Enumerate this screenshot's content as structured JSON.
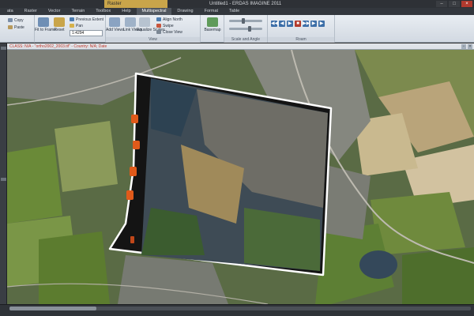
{
  "window": {
    "title": "Untitled1 - ERDAS IMAGINE 2011",
    "contextual_tab": "Raster",
    "controls": [
      "–",
      "□",
      "×"
    ]
  },
  "menu": {
    "tabs": [
      "ata",
      "Raster",
      "Vector",
      "Terrain",
      "Toolbox",
      "Help",
      "Multispectral",
      "Drawing",
      "Format",
      "Table"
    ]
  },
  "ribbon": {
    "edit": {
      "copy": "Copy",
      "paste": "Paste"
    },
    "extent": {
      "fit_to_frame": "Fit to Frame",
      "reset": "Reset",
      "previous_extent": "Previous Extent",
      "pan": "Pan",
      "scale_value": "1:4294"
    },
    "view": {
      "add_views": "Add Views",
      "link_views": "Link Views",
      "equalize_scales": "Equalize Scales",
      "align_north": "Align North",
      "swipe": "Swipe",
      "close_view": "Close View",
      "basemap": "Basemap",
      "label": "View"
    },
    "scale_labels": {
      "label": "Scale and Angle"
    },
    "roam": {
      "label": "Roam"
    },
    "nav_buttons": [
      "◀◀",
      "◀",
      "▶",
      "■",
      "▶▶",
      "▶",
      "▶"
    ]
  },
  "viewer": {
    "title": "CLASS: N/A - \"ortho2002_2003.tif\" - Country: N/A; Date"
  },
  "status": {
    "text": ""
  },
  "colors": {
    "accent": "#c9a54a",
    "map_bg": "#4d5a3b",
    "overlay_border": "#ffffff",
    "fiducial": "#e05a1a"
  }
}
